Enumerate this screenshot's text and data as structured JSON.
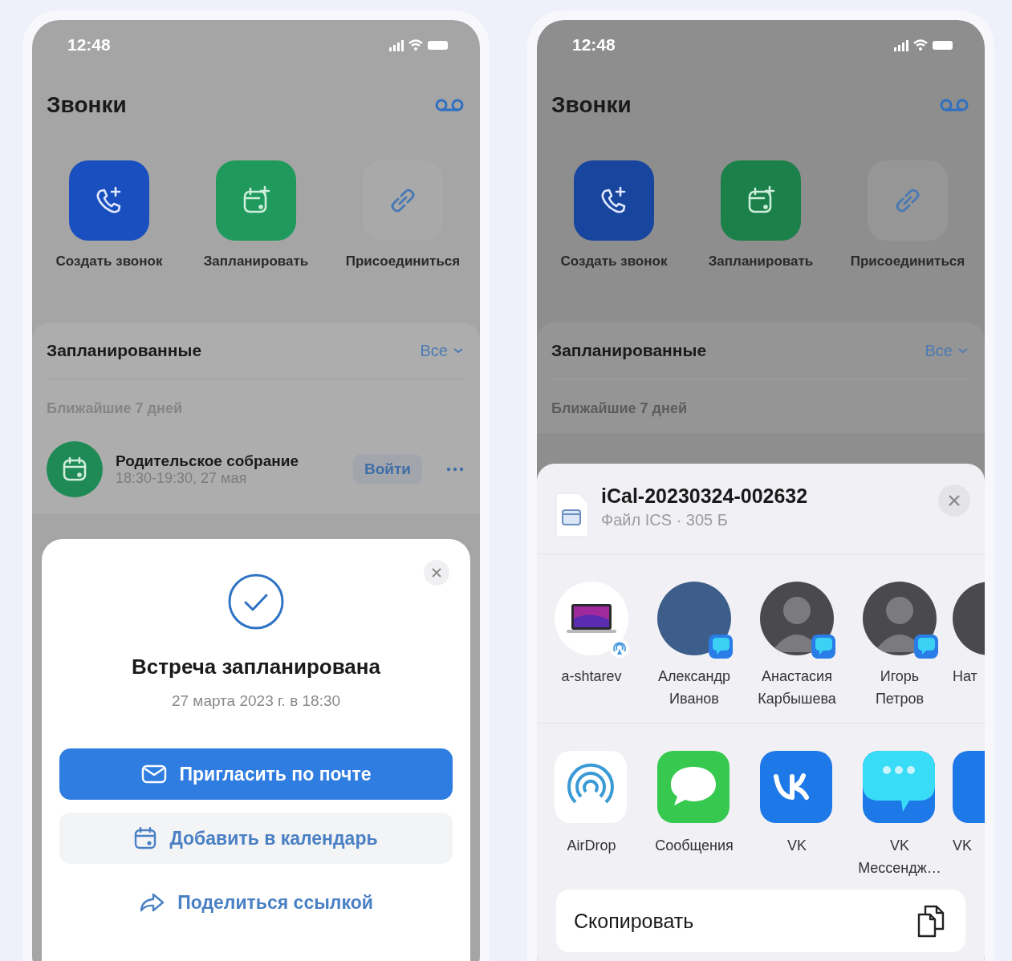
{
  "phones": [
    {
      "kind": "dialog",
      "status_bar": {
        "time": "12:48"
      },
      "title": "Звонки",
      "actions": [
        {
          "kind": "call",
          "label": "Создать звонок",
          "color": "#1a4fbf"
        },
        {
          "kind": "schedule",
          "label": "Запланировать",
          "color": "#1f9a5c"
        },
        {
          "kind": "link",
          "label": "Присоединиться",
          "color": "#a9a9a9"
        }
      ],
      "scheduled": {
        "title": "Запланированные",
        "filter": "Все",
        "group": "Ближайшие 7 дней",
        "meeting": {
          "title": "Родительское собрание",
          "time": "18:30-19:30, 27 мая",
          "join": "Войти"
        }
      },
      "dialog": {
        "title": "Встреча запланирована",
        "date": "27 марта 2023 г. в 18:30",
        "buttons": [
          {
            "kind": "primary",
            "label": "Пригласить по почте"
          },
          {
            "kind": "secondary",
            "label": "Добавить в календарь"
          },
          {
            "kind": "link",
            "label": "Поделиться ссылкой"
          }
        ]
      }
    },
    {
      "kind": "share",
      "status_bar": {
        "time": "12:48"
      },
      "title": "Звонки",
      "actions": [
        {
          "kind": "call",
          "label": "Создать звонок",
          "color": "#18459e"
        },
        {
          "kind": "schedule",
          "label": "Запланировать",
          "color": "#1b8049"
        },
        {
          "kind": "link",
          "label": "Присоединиться",
          "color": "#969696"
        }
      ],
      "scheduled": {
        "title": "Запланированные",
        "filter": "Все",
        "group": "Ближайшие 7 дней"
      },
      "share": {
        "file": {
          "name": "iCal-20230324-002632",
          "meta": "Файл ICS · 305 Б"
        },
        "contacts": [
          {
            "kind": "device",
            "name": "a-shtarev"
          },
          {
            "kind": "photo",
            "name": "Александр Иванов"
          },
          {
            "kind": "person",
            "name": "Анастасия Карбышева"
          },
          {
            "kind": "person",
            "name": "Игорь Петров"
          },
          {
            "kind": "partial",
            "name": "Нат"
          }
        ],
        "apps": [
          {
            "kind": "airdrop",
            "name": "AirDrop"
          },
          {
            "kind": "messages",
            "name": "Сообщения"
          },
          {
            "kind": "vk",
            "name": "VK"
          },
          {
            "kind": "vk_messenger",
            "name": "VK Мессендж…"
          },
          {
            "kind": "partial",
            "name": "VK"
          }
        ],
        "copy": "Скопировать"
      }
    }
  ]
}
